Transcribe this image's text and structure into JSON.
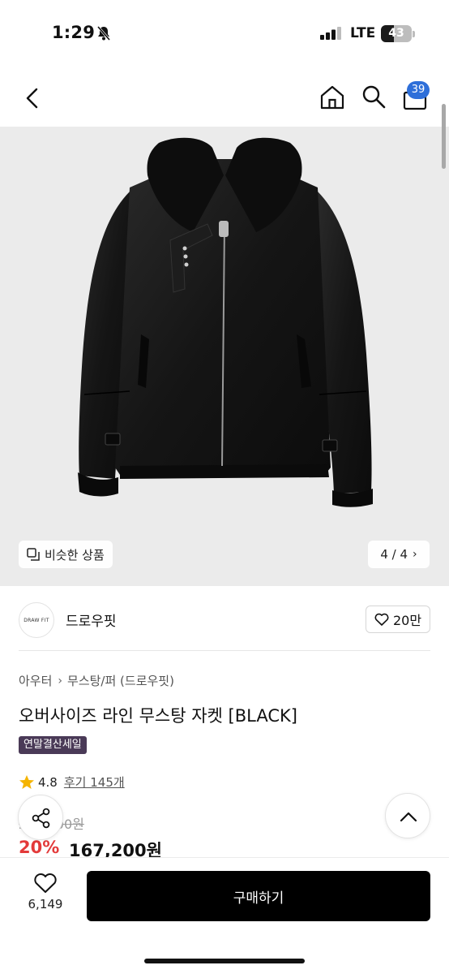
{
  "status": {
    "time": "1:29",
    "network": "LTE",
    "battery": "43",
    "battery_level": 0.43
  },
  "nav": {
    "cart_count": "39"
  },
  "gallery": {
    "similar_label": "비슷한 상품",
    "counter": "4 / 4"
  },
  "brand": {
    "logo_text": "DRAW FIT",
    "name": "드로우핏",
    "likes": "20만"
  },
  "breadcrumb": {
    "level1": "아우터",
    "level2": "무스탕/퍼 (드로우핏)"
  },
  "product": {
    "title": "오버사이즈 라인 무스탕 자켓 [BLACK]",
    "sale_tag": "연말결산세일",
    "rating": "4.8",
    "reviews": "후기 145개",
    "original_price": "209,000원",
    "discount": "20%",
    "price": "167,200원"
  },
  "bottom": {
    "wish_count": "6,149",
    "buy_label": "구매하기"
  },
  "colors": {
    "accent_blue": "#2e6fd9",
    "sale_red": "#e33a3a",
    "tag_purple": "#4a3a57",
    "star": "#f5b400"
  }
}
